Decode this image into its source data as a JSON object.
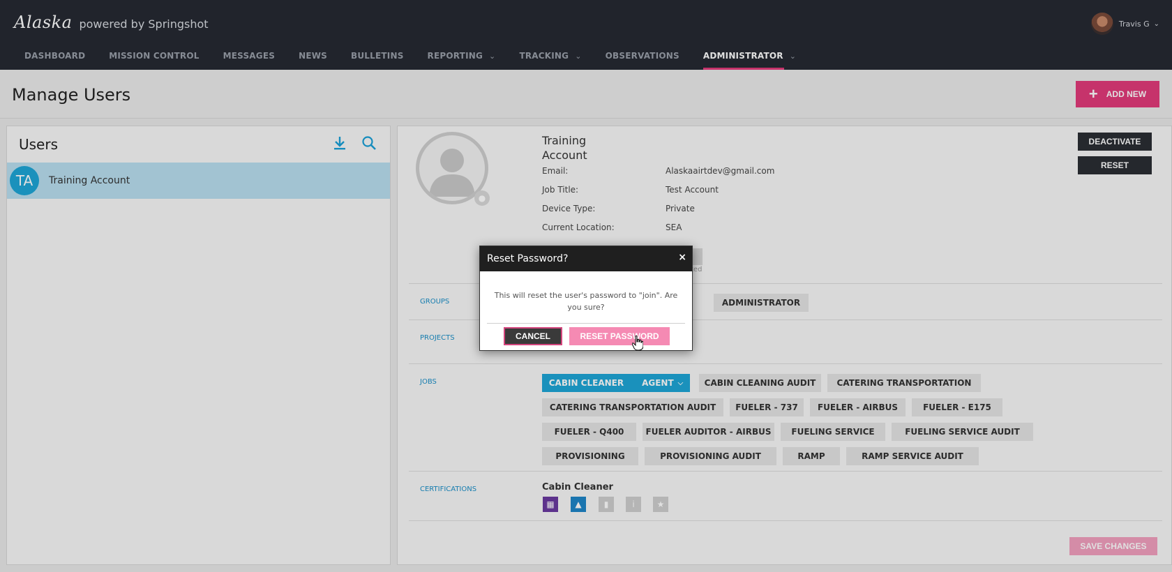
{
  "brand": {
    "logo": "Alaska",
    "powered_by": "powered by Springshot"
  },
  "user_menu": {
    "name": "Travis G"
  },
  "nav": {
    "items": [
      {
        "label": "DASHBOARD",
        "dropdown": false
      },
      {
        "label": "MISSION CONTROL",
        "dropdown": false
      },
      {
        "label": "MESSAGES",
        "dropdown": false
      },
      {
        "label": "NEWS",
        "dropdown": false
      },
      {
        "label": "BULLETINS",
        "dropdown": false
      },
      {
        "label": "REPORTING",
        "dropdown": true
      },
      {
        "label": "TRACKING",
        "dropdown": true
      },
      {
        "label": "OBSERVATIONS",
        "dropdown": false
      },
      {
        "label": "ADMINISTRATOR",
        "dropdown": true,
        "active": true
      }
    ]
  },
  "page": {
    "title": "Manage Users",
    "add_new_label": "ADD NEW"
  },
  "users_panel": {
    "title": "Users",
    "users": [
      {
        "initials": "TA",
        "name": "Training Account",
        "selected": true
      }
    ]
  },
  "detail": {
    "name_line1": "Training",
    "name_line2": "Account",
    "fields": [
      {
        "label": "Email:",
        "value": "Alaskaairtdev@gmail.com"
      },
      {
        "label": "Job Title:",
        "value": "Test Account"
      },
      {
        "label": "Device Type:",
        "value": "Private"
      },
      {
        "label": "Current Location:",
        "value": "SEA"
      }
    ],
    "partial_text": "ted",
    "deactivate_label": "DEACTIVATE",
    "reset_label": "RESET",
    "sections": {
      "groups": "GROUPS",
      "projects": "PROJECTS",
      "jobs": "JOBS",
      "certifications": "CERTIFICATIONS"
    },
    "groups": [
      "ADMINISTRATOR"
    ],
    "jobs": {
      "active": {
        "label": "CABIN CLEANER",
        "sub": "AGENT"
      },
      "others": [
        "CABIN CLEANING AUDIT",
        "CATERING TRANSPORTATION",
        "CATERING TRANSPORTATION AUDIT",
        "FUELER - 737",
        "FUELER - AIRBUS",
        "FUELER - E175",
        "FUELER - Q400",
        "FUELER AUDITOR - AIRBUS",
        "FUELING SERVICE",
        "FUELING SERVICE AUDIT",
        "PROVISIONING",
        "PROVISIONING AUDIT",
        "RAMP",
        "RAMP SERVICE AUDIT"
      ]
    },
    "certification_title": "Cabin Cleaner",
    "certification_icons": [
      {
        "name": "restroom-icon",
        "color": "#6a3aa0"
      },
      {
        "name": "cleaning-icon",
        "color": "#1e86c8"
      },
      {
        "name": "trash-icon",
        "color": "#cfcfcf"
      },
      {
        "name": "info-icon",
        "color": "#cfcfcf"
      },
      {
        "name": "star-icon",
        "color": "#cfcfcf"
      }
    ],
    "save_label": "SAVE CHANGES"
  },
  "modal": {
    "title": "Reset Password?",
    "close_glyph": "×",
    "message": "This will reset the user's password to \"join\". Are you sure?",
    "cancel_label": "CANCEL",
    "confirm_label": "RESET PASSWORD"
  },
  "colors": {
    "accent": "#e23b7a",
    "primary_blue": "#1ea6d6",
    "nav_bg": "#262a33"
  }
}
